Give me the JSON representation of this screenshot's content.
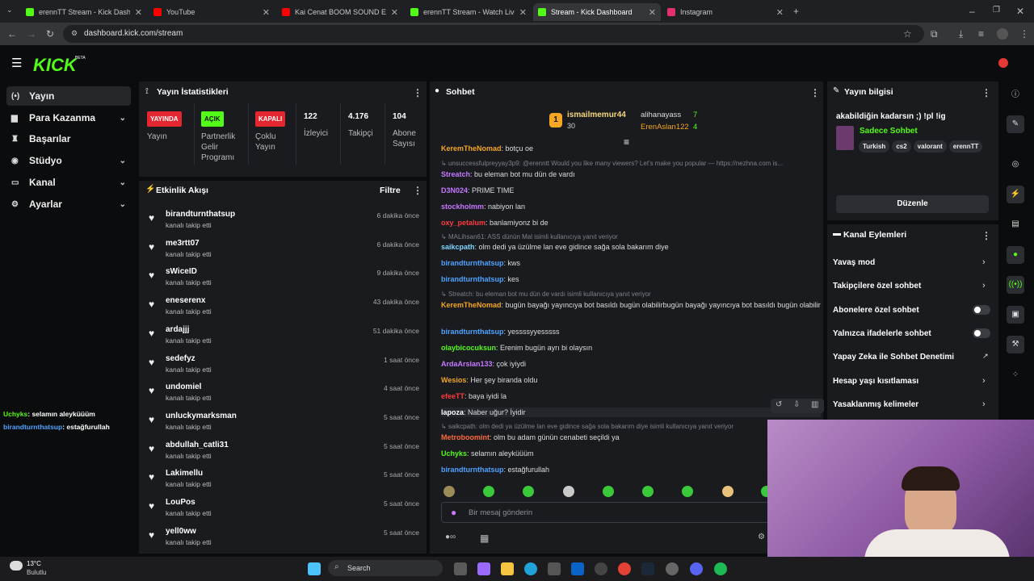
{
  "browser": {
    "tabs": [
      {
        "title": "erennTT Stream - Kick Dashboard",
        "color": "#53fc18"
      },
      {
        "title": "YouTube",
        "color": "#ff0000"
      },
      {
        "title": "Kai Cenat BOOM SOUND EFFECT",
        "color": "#ff0000"
      },
      {
        "title": "erennTT Stream - Watch Live on",
        "color": "#53fc18"
      },
      {
        "title": "Stream - Kick Dashboard",
        "color": "#53fc18"
      },
      {
        "title": "Instagram",
        "color": "#e1306c"
      }
    ],
    "url": "dashboard.kick.com/stream"
  },
  "app": {
    "logo": "KICK",
    "beta": "BETA"
  },
  "sidebar": {
    "items": [
      {
        "label": "Yayın",
        "icon": "stream-icon"
      },
      {
        "label": "Para Kazanma",
        "icon": "money-icon"
      },
      {
        "label": "Başarılar",
        "icon": "trophy-icon"
      },
      {
        "label": "Stüdyo",
        "icon": "studio-icon"
      },
      {
        "label": "Kanal",
        "icon": "channel-icon"
      },
      {
        "label": "Ayarlar",
        "icon": "gear-icon"
      }
    ],
    "overlay_chat": [
      {
        "user": "Uchyks",
        "text": ": selamın aleyküüüm"
      },
      {
        "user": "birandturnthatsup",
        "text": ": estağfurullah"
      }
    ]
  },
  "stats": {
    "title": "Yayın İstatistikleri",
    "cols": [
      {
        "badge": "YAYINDA",
        "label": "Yayın"
      },
      {
        "badge": "AÇIK",
        "label": "Partnerlik Gelir Programı"
      },
      {
        "badge": "KAPALI",
        "label": "Çoklu Yayın"
      },
      {
        "value": "122",
        "label": "İzleyici"
      },
      {
        "value": "4.176",
        "label": "Takipçi"
      },
      {
        "value": "104",
        "label": "Abone Sayısı"
      }
    ]
  },
  "activity": {
    "title": "Etkinlik Akışı",
    "filter": "Filtre",
    "sub": "kanalı takip etti",
    "items": [
      {
        "name": "birandturnthatsup",
        "time": "6 dakika önce"
      },
      {
        "name": "me3rtt07",
        "time": "6 dakika önce"
      },
      {
        "name": "sWiceID",
        "time": "9 dakika önce"
      },
      {
        "name": "eneserenx",
        "time": "43 dakika önce"
      },
      {
        "name": "ardajjj",
        "time": "51 dakika önce"
      },
      {
        "name": "sedefyz",
        "time": "1 saat önce"
      },
      {
        "name": "undomiel",
        "time": "4 saat önce"
      },
      {
        "name": "unluckymarksman",
        "time": "5 saat önce"
      },
      {
        "name": "abdullah_catli31",
        "time": "5 saat önce"
      },
      {
        "name": "Lakimellu",
        "time": "5 saat önce"
      },
      {
        "name": "LouPos",
        "time": "5 saat önce"
      },
      {
        "name": "yell0ww",
        "time": "5 saat önce"
      }
    ]
  },
  "chat": {
    "title": "Sohbet",
    "leaders": [
      {
        "rank": "1",
        "name": "ismailmemur44",
        "count": "30"
      },
      {
        "name": "alihanayass",
        "count": "7"
      },
      {
        "name": "ErenAslan122",
        "count": "4"
      }
    ],
    "messages": [
      {
        "user": "KeremTheNomad",
        "color": "#f5a623",
        "text": ": botçu oe"
      },
      {
        "reply": "unsuccessfulpreyyay3p9: @erenntt Would you like many viewers? Let's make you popular — https://nezhna.com is..."
      },
      {
        "user": "Streatch",
        "color": "#c678ff",
        "text": ": bu eleman bot mu dün de vardı"
      },
      {
        "user": "D3N024",
        "color": "#c678ff",
        "text": ": PRIME TIME"
      },
      {
        "user": "stockholmm",
        "color": "#c678ff",
        "text": ": nabiyon lan"
      },
      {
        "user": "oxy_petalum",
        "color": "#ff3b3b",
        "text": ": banlamiyonz bi de"
      },
      {
        "reply": "MALihsan61: ASS dünün Mal isimli kullanıcıya yanıt veriyor"
      },
      {
        "user": "saikcpath",
        "color": "#7fd7ff",
        "text": ": olm dedi ya üzülme lan eve gidince sağa sola bakarım diye"
      },
      {
        "user": "birandturnthatsup",
        "color": "#4ea3ff",
        "text": ": kws"
      },
      {
        "user": "birandturnthatsup",
        "color": "#4ea3ff",
        "text": ": kes"
      },
      {
        "reply": "Streatch: bu eleman bot mu dün de vardı isimli kullanıcıya yanıt veriyor"
      },
      {
        "user": "KeremTheNomad",
        "color": "#f5a623",
        "text": ": bugün bayağı yayıncıya bot basıldı bugün olabilirbugün bayağı yayıncıya bot basıldı bugün olabilir"
      },
      {
        "user": "birandturnthatsup",
        "color": "#4ea3ff",
        "text": ": yessssyyesssss"
      },
      {
        "user": "olaybicocuksun",
        "color": "#53fc18",
        "text": ": Erenim bugün ayrı bi olaysın"
      },
      {
        "user": "ArdaArslan133",
        "color": "#c678ff",
        "text": ": çok iyiydi"
      },
      {
        "user": "Wesios",
        "color": "#f5a623",
        "text": ": Her şey biranda oldu"
      },
      {
        "user": "efeeTT",
        "color": "#ff3b3b",
        "text": ": baya iyidi la"
      },
      {
        "user": "lapoza",
        "color": "#ffffff",
        "text": ": Naber uğur? İyidir"
      },
      {
        "reply": "saikcpath: olm dedi ya üzülme lan eve gidince sağa sola bakarım diye isimli kullanıcıya yanıt veriyor"
      },
      {
        "user": "Metroboomint",
        "color": "#ff6a3b",
        "text": ": olm bu adam günün cenabeti seçildi ya"
      },
      {
        "user": "Uchyks",
        "color": "#53fc18",
        "text": ": selamın aleyküüüm"
      },
      {
        "user": "birandturnthatsup",
        "color": "#4ea3ff",
        "text": ": estağfurullah"
      }
    ],
    "placeholder": "Bir mesaj gönderin"
  },
  "info": {
    "title": "Yayın bilgisi",
    "stream_title": "akabildiğin kadarsın ;) !pl !ig",
    "category": "Sadece Sohbet",
    "tags": [
      "Turkish",
      "cs2",
      "valorant",
      "erennTT"
    ],
    "edit": "Düzenle"
  },
  "channel_actions": {
    "title": "Kanal Eylemleri",
    "items": [
      {
        "label": "Yavaş mod",
        "kind": "arrow"
      },
      {
        "label": "Takipçilere özel sohbet",
        "kind": "arrow"
      },
      {
        "label": "Abonelere özel sohbet",
        "kind": "toggle"
      },
      {
        "label": "Yalnızca ifadelerle sohbet",
        "kind": "toggle"
      },
      {
        "label": "Yapay Zeka ile Sohbet Denetimi",
        "kind": "external"
      },
      {
        "label": "Hesap yaşı kısıtlaması",
        "kind": "arrow"
      },
      {
        "label": "Yasaklanmış kelimeler",
        "kind": "arrow"
      }
    ]
  },
  "taskbar": {
    "weather_temp": "13°C",
    "weather_desc": "Bulutlu",
    "search": "Search"
  },
  "colors": {
    "accent": "#53fc18",
    "panel": "#191b1f",
    "bg": "#0b0c0d"
  }
}
